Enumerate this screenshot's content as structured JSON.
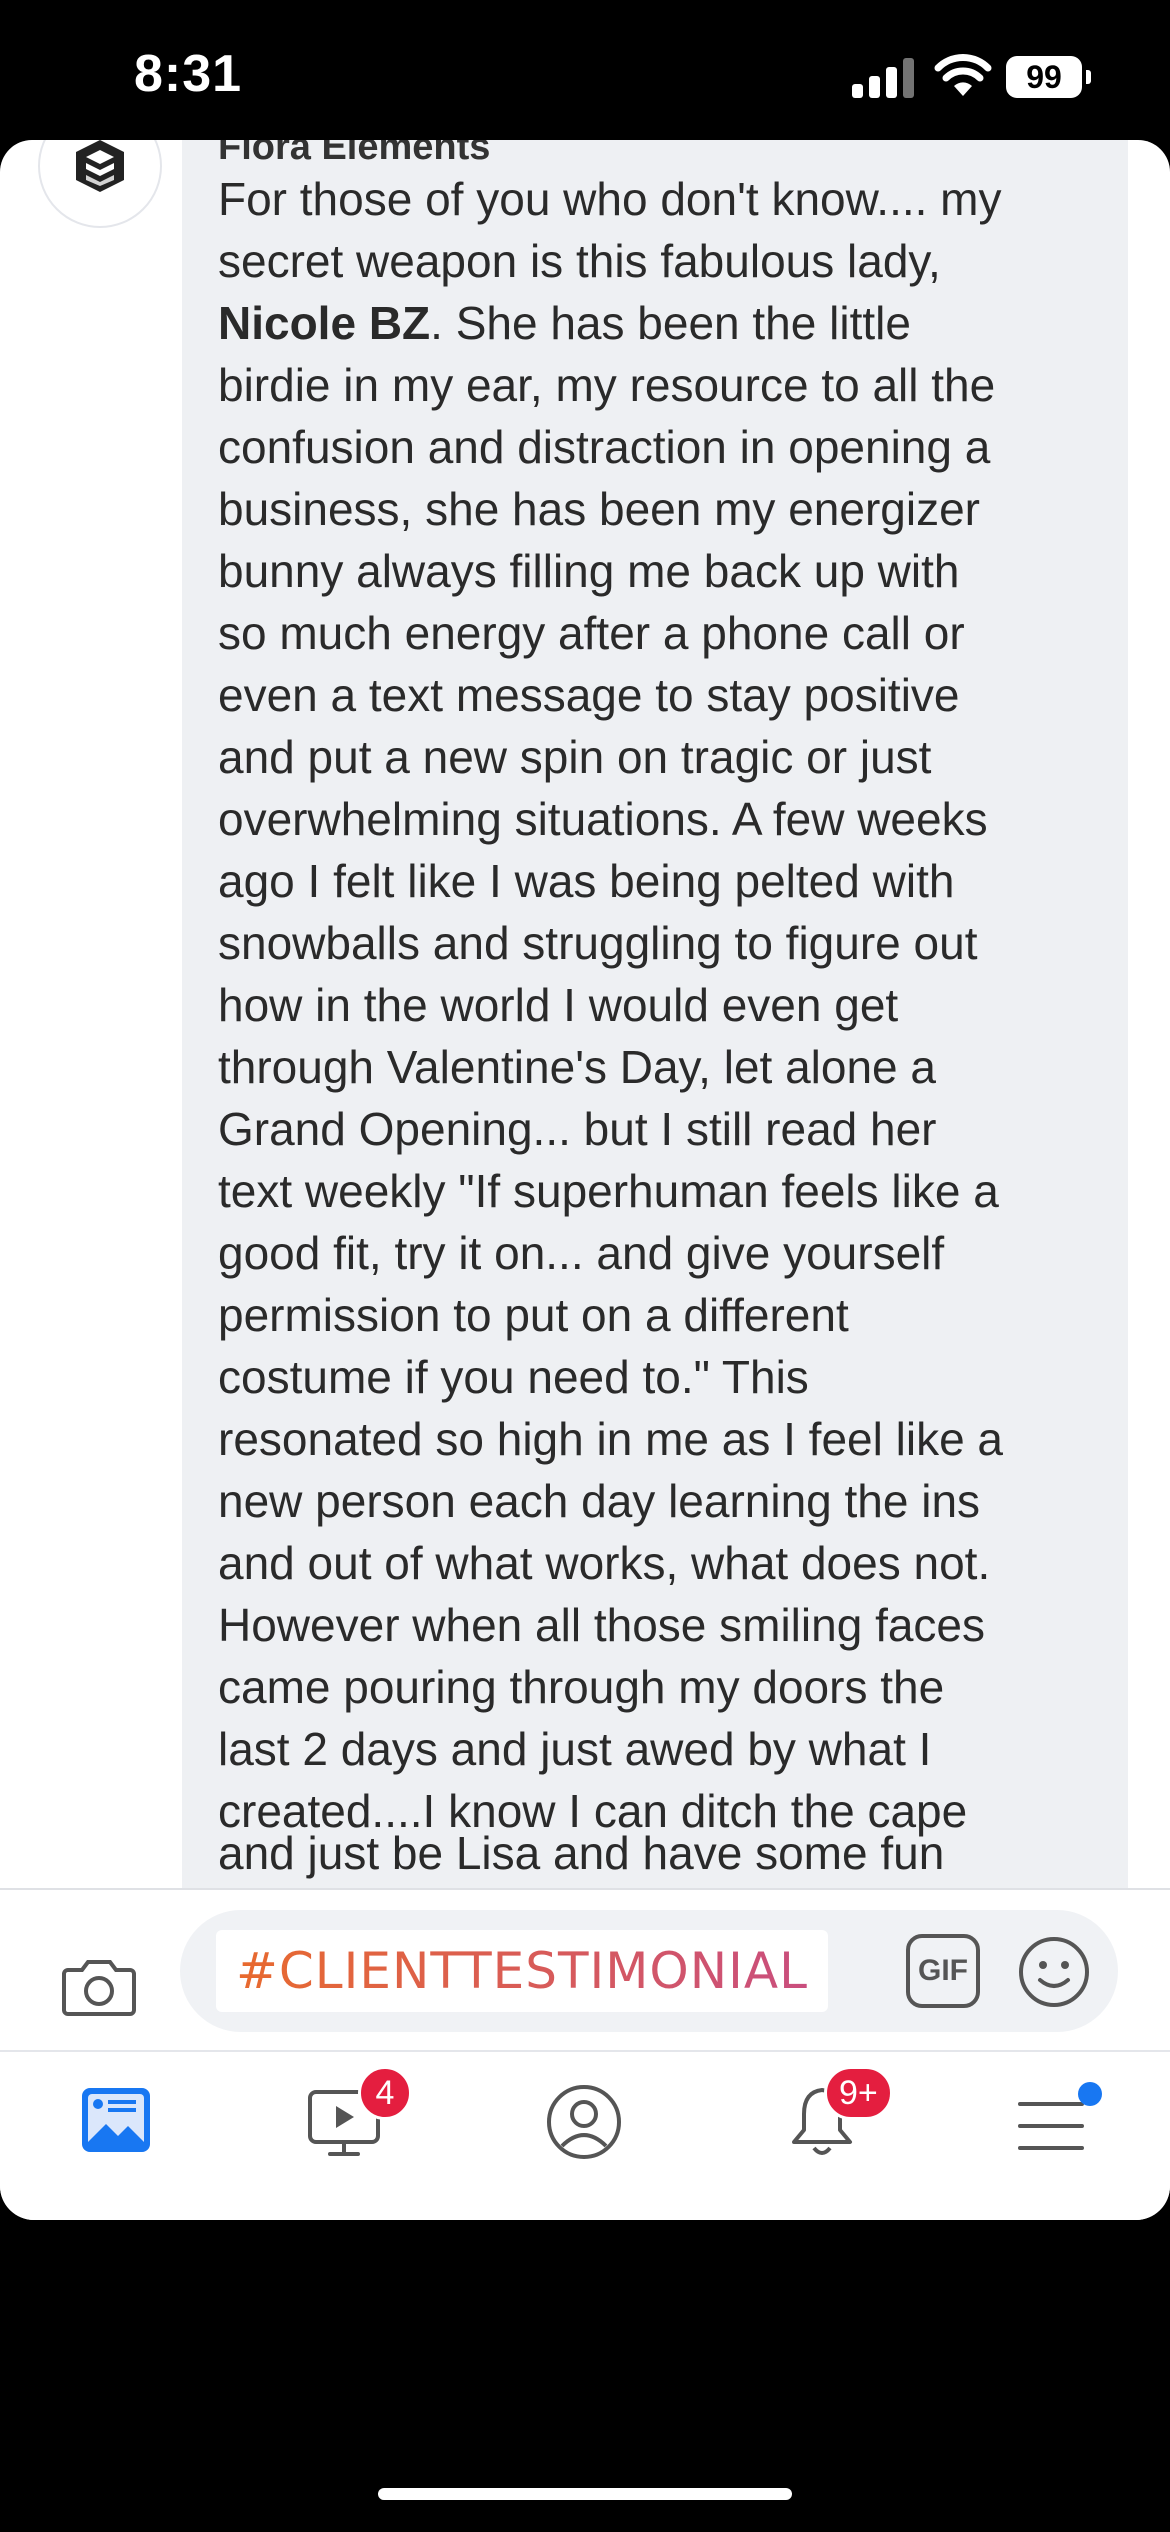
{
  "status_bar": {
    "time": "8:31",
    "battery": "99",
    "icons": [
      "signal-icon",
      "wifi-icon",
      "battery-icon"
    ]
  },
  "post": {
    "author": "Flora Elements",
    "lines": [
      "For those of you who don't know.... my",
      "secret weapon is this fabulous lady,",
      "",
      "birdie in my ear, my resource to all the",
      "confusion and distraction in opening a",
      "business, she has been my energizer",
      "bunny always filling me back up with",
      "so much energy after a phone call or",
      "even a text message to stay positive",
      "and put a new spin on tragic or just",
      "overwhelming situations. A few weeks",
      "ago I felt like I was being pelted with",
      "snowballs and struggling to figure out",
      "how in the world I would even get",
      "through Valentine's Day, let alone a",
      "Grand Opening... but I still read her",
      "text weekly \"If superhuman feels like a",
      "good fit, try it on... and give yourself",
      "permission to put on a different",
      "costume if you need to.\" This",
      "resonated so high in me as I feel like a",
      "new person each day learning the ins",
      "and out of what works, what does not.",
      "However when all those smiling faces",
      "came pouring through my doors the",
      "last 2 days and just awed by what I",
      "created....I know I can ditch the cape"
    ],
    "mention": "Nicole BZ",
    "mention_rest": ". She has been the little",
    "cut_line": "and just be Lisa and have some fun"
  },
  "composer": {
    "hashtag": "#CLIENTTESTIMONIAL",
    "gif_label": "GIF"
  },
  "tabbar": {
    "video_badge": "4",
    "notifications_badge": "9+"
  },
  "colors": {
    "bubble": "#eef0f3",
    "badge": "#e41e3f",
    "accent": "#1877f2"
  }
}
